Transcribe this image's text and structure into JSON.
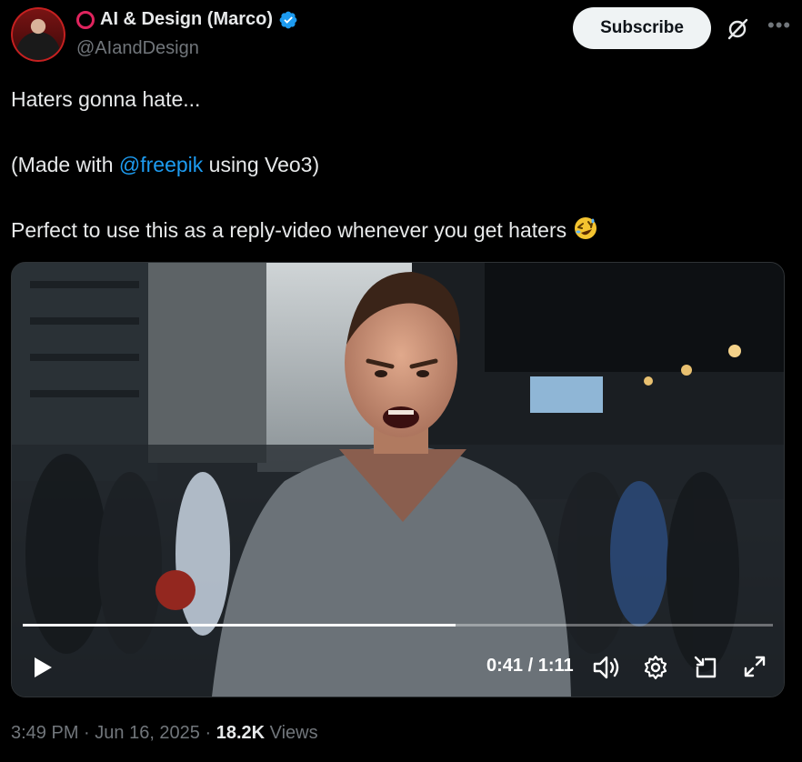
{
  "author": {
    "display_name": "AI & Design (Marco)",
    "handle": "@AIandDesign",
    "verified_color": "#1d9bf0"
  },
  "header": {
    "subscribe_label": "Subscribe"
  },
  "tweet": {
    "line1": "Haters gonna hate...",
    "line2_prefix": "(Made with ",
    "line2_mention": "@freepik",
    "line2_suffix": " using Veo3)",
    "line3": "Perfect to use this as a reply-video whenever you get haters",
    "emoji_name": "rolling-on-floor-laughing"
  },
  "video": {
    "current_time": "0:41",
    "separator": " / ",
    "duration": "1:11",
    "progress_fraction": 0.577
  },
  "meta": {
    "time": "3:49 PM",
    "dot1": " · ",
    "date": "Jun 16, 2025",
    "dot2": " · ",
    "views_count": "18.2K",
    "views_label": " Views"
  },
  "colors": {
    "background": "#000000",
    "text": "#e7e9ea",
    "muted": "#71767b",
    "accent": "#1d9bf0",
    "live_ring": "#e0245e"
  }
}
